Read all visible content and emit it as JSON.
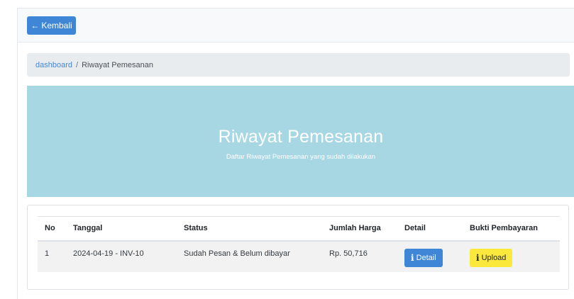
{
  "topbar": {
    "back_label": "Kembali",
    "back_icon": "arrow-left-icon"
  },
  "breadcrumb": {
    "home": "dashboard",
    "separator": "/",
    "current": "Riwayat Pemesanan"
  },
  "hero": {
    "title": "Riwayat Pemesanan",
    "subtitle": "Daftar Riwayat Pemesanan yang sudah dilakukan"
  },
  "table": {
    "headers": [
      "No",
      "Tanggal",
      "Status",
      "Jumlah Harga",
      "Detail",
      "Bukti Pembayaran"
    ],
    "rows": [
      {
        "no": "1",
        "tanggal": "2024-04-19 - INV-10",
        "status": "Sudah Pesan & Belum dibayar",
        "harga": "Rp. 50,716",
        "detail_label": "Detail",
        "upload_label": "Upload"
      }
    ]
  },
  "colors": {
    "primary": "#3f87d6",
    "hero_bg": "#a8d7e4",
    "warning": "#fbe83d"
  }
}
